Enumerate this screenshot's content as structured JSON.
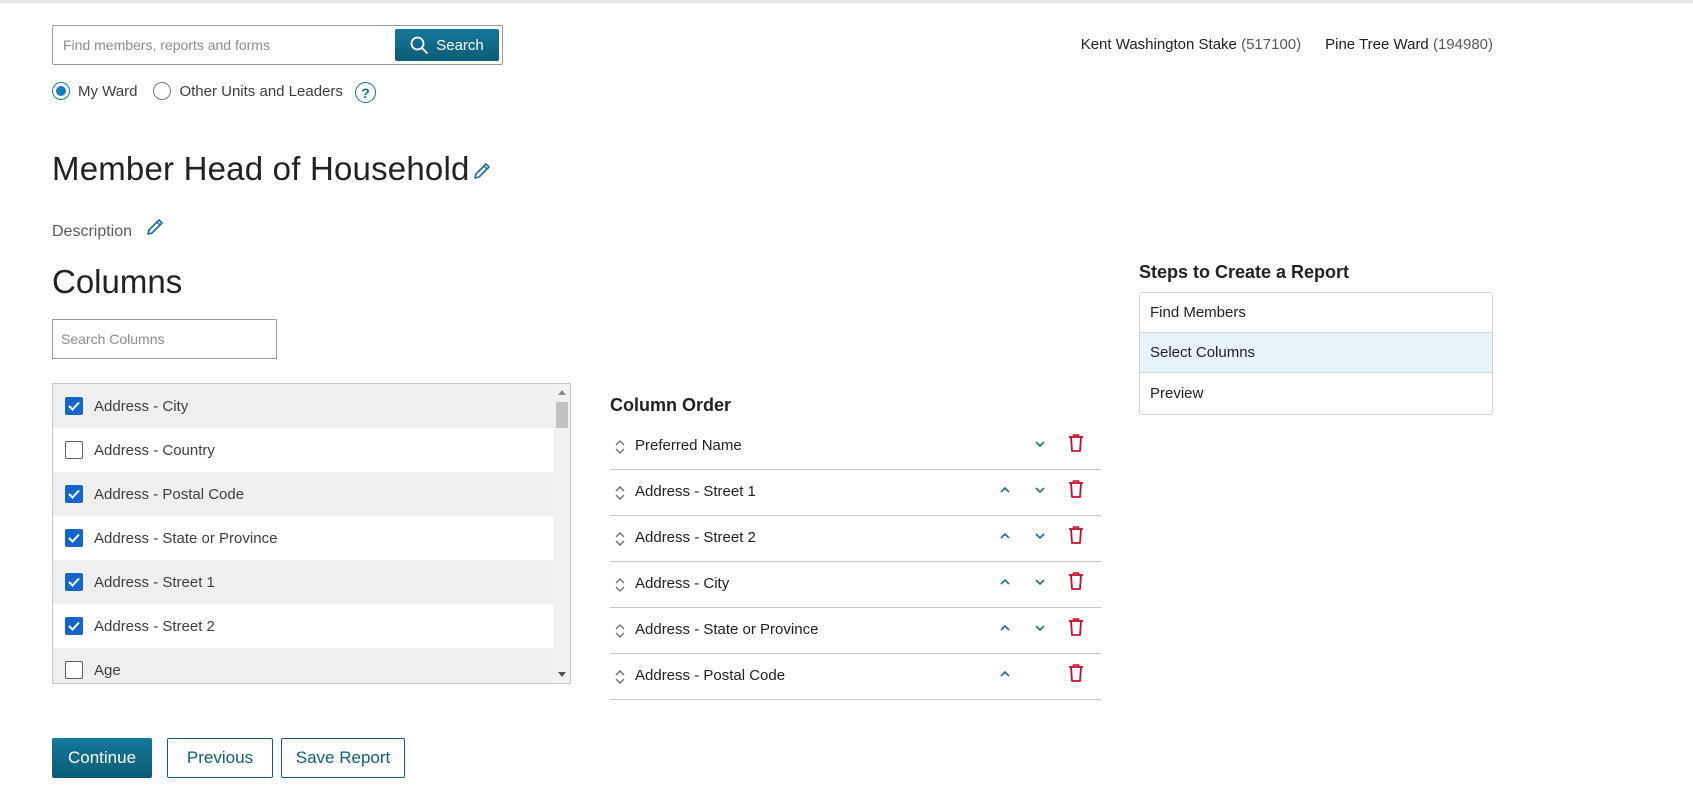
{
  "search": {
    "placeholder": "Find members, reports and forms",
    "button_label": "Search"
  },
  "scope": {
    "options": [
      {
        "label": "My Ward",
        "selected": true
      },
      {
        "label": "Other Units and Leaders",
        "selected": false
      }
    ],
    "help_icon": "question-circle-icon",
    "help_glyph": "?"
  },
  "units": {
    "stake_name": "Kent Washington Stake",
    "stake_number": "(517100)",
    "ward_name": "Pine Tree Ward",
    "ward_number": "(194980)"
  },
  "report": {
    "title": "Member Head of Household",
    "description_label": "Description"
  },
  "columns": {
    "heading": "Columns",
    "search_placeholder": "Search Columns",
    "items": [
      {
        "label": "Address - City",
        "checked": true
      },
      {
        "label": "Address - Country",
        "checked": false
      },
      {
        "label": "Address - Postal Code",
        "checked": true
      },
      {
        "label": "Address - State or Province",
        "checked": true
      },
      {
        "label": "Address - Street 1",
        "checked": true
      },
      {
        "label": "Address - Street 2",
        "checked": true
      },
      {
        "label": "Age",
        "checked": false
      }
    ]
  },
  "column_order": {
    "heading": "Column Order",
    "rows": [
      {
        "label": "Preferred Name",
        "up": false,
        "down": true
      },
      {
        "label": "Address - Street 1",
        "up": true,
        "down": true
      },
      {
        "label": "Address - Street 2",
        "up": true,
        "down": true
      },
      {
        "label": "Address - City",
        "up": true,
        "down": true
      },
      {
        "label": "Address - State or Province",
        "up": true,
        "down": true
      },
      {
        "label": "Address - Postal Code",
        "up": true,
        "down": false
      }
    ]
  },
  "steps": {
    "heading": "Steps to Create a Report",
    "items": [
      {
        "label": "Find Members",
        "active": false
      },
      {
        "label": "Select Columns",
        "active": true
      },
      {
        "label": "Preview",
        "active": false
      }
    ]
  },
  "footer": {
    "continue_label": "Continue",
    "previous_label": "Previous",
    "save_label": "Save Report"
  },
  "colors": {
    "primary": "#0f6a86",
    "checkbox": "#1467c8",
    "delete": "#c8102e",
    "active_step": "#e6f3fa"
  }
}
